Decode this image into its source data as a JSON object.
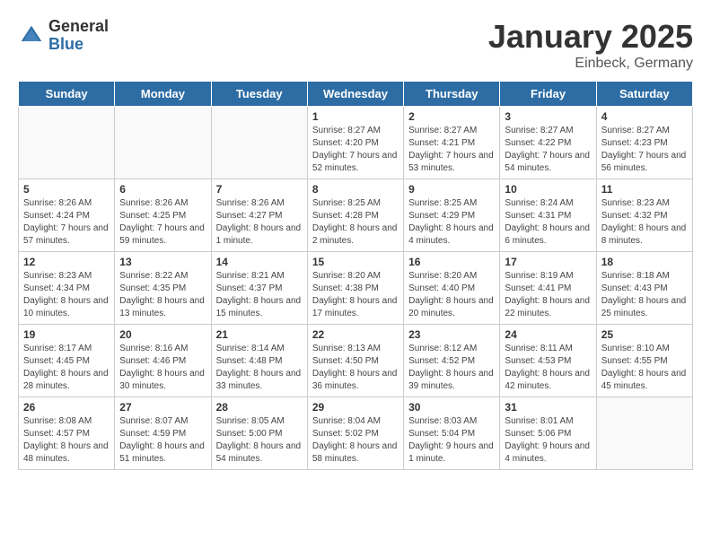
{
  "header": {
    "logo_general": "General",
    "logo_blue": "Blue",
    "month_title": "January 2025",
    "location": "Einbeck, Germany"
  },
  "weekdays": [
    "Sunday",
    "Monday",
    "Tuesday",
    "Wednesday",
    "Thursday",
    "Friday",
    "Saturday"
  ],
  "weeks": [
    [
      {
        "day": "",
        "info": ""
      },
      {
        "day": "",
        "info": ""
      },
      {
        "day": "",
        "info": ""
      },
      {
        "day": "1",
        "info": "Sunrise: 8:27 AM\nSunset: 4:20 PM\nDaylight: 7 hours and 52 minutes."
      },
      {
        "day": "2",
        "info": "Sunrise: 8:27 AM\nSunset: 4:21 PM\nDaylight: 7 hours and 53 minutes."
      },
      {
        "day": "3",
        "info": "Sunrise: 8:27 AM\nSunset: 4:22 PM\nDaylight: 7 hours and 54 minutes."
      },
      {
        "day": "4",
        "info": "Sunrise: 8:27 AM\nSunset: 4:23 PM\nDaylight: 7 hours and 56 minutes."
      }
    ],
    [
      {
        "day": "5",
        "info": "Sunrise: 8:26 AM\nSunset: 4:24 PM\nDaylight: 7 hours and 57 minutes."
      },
      {
        "day": "6",
        "info": "Sunrise: 8:26 AM\nSunset: 4:25 PM\nDaylight: 7 hours and 59 minutes."
      },
      {
        "day": "7",
        "info": "Sunrise: 8:26 AM\nSunset: 4:27 PM\nDaylight: 8 hours and 1 minute."
      },
      {
        "day": "8",
        "info": "Sunrise: 8:25 AM\nSunset: 4:28 PM\nDaylight: 8 hours and 2 minutes."
      },
      {
        "day": "9",
        "info": "Sunrise: 8:25 AM\nSunset: 4:29 PM\nDaylight: 8 hours and 4 minutes."
      },
      {
        "day": "10",
        "info": "Sunrise: 8:24 AM\nSunset: 4:31 PM\nDaylight: 8 hours and 6 minutes."
      },
      {
        "day": "11",
        "info": "Sunrise: 8:23 AM\nSunset: 4:32 PM\nDaylight: 8 hours and 8 minutes."
      }
    ],
    [
      {
        "day": "12",
        "info": "Sunrise: 8:23 AM\nSunset: 4:34 PM\nDaylight: 8 hours and 10 minutes."
      },
      {
        "day": "13",
        "info": "Sunrise: 8:22 AM\nSunset: 4:35 PM\nDaylight: 8 hours and 13 minutes."
      },
      {
        "day": "14",
        "info": "Sunrise: 8:21 AM\nSunset: 4:37 PM\nDaylight: 8 hours and 15 minutes."
      },
      {
        "day": "15",
        "info": "Sunrise: 8:20 AM\nSunset: 4:38 PM\nDaylight: 8 hours and 17 minutes."
      },
      {
        "day": "16",
        "info": "Sunrise: 8:20 AM\nSunset: 4:40 PM\nDaylight: 8 hours and 20 minutes."
      },
      {
        "day": "17",
        "info": "Sunrise: 8:19 AM\nSunset: 4:41 PM\nDaylight: 8 hours and 22 minutes."
      },
      {
        "day": "18",
        "info": "Sunrise: 8:18 AM\nSunset: 4:43 PM\nDaylight: 8 hours and 25 minutes."
      }
    ],
    [
      {
        "day": "19",
        "info": "Sunrise: 8:17 AM\nSunset: 4:45 PM\nDaylight: 8 hours and 28 minutes."
      },
      {
        "day": "20",
        "info": "Sunrise: 8:16 AM\nSunset: 4:46 PM\nDaylight: 8 hours and 30 minutes."
      },
      {
        "day": "21",
        "info": "Sunrise: 8:14 AM\nSunset: 4:48 PM\nDaylight: 8 hours and 33 minutes."
      },
      {
        "day": "22",
        "info": "Sunrise: 8:13 AM\nSunset: 4:50 PM\nDaylight: 8 hours and 36 minutes."
      },
      {
        "day": "23",
        "info": "Sunrise: 8:12 AM\nSunset: 4:52 PM\nDaylight: 8 hours and 39 minutes."
      },
      {
        "day": "24",
        "info": "Sunrise: 8:11 AM\nSunset: 4:53 PM\nDaylight: 8 hours and 42 minutes."
      },
      {
        "day": "25",
        "info": "Sunrise: 8:10 AM\nSunset: 4:55 PM\nDaylight: 8 hours and 45 minutes."
      }
    ],
    [
      {
        "day": "26",
        "info": "Sunrise: 8:08 AM\nSunset: 4:57 PM\nDaylight: 8 hours and 48 minutes."
      },
      {
        "day": "27",
        "info": "Sunrise: 8:07 AM\nSunset: 4:59 PM\nDaylight: 8 hours and 51 minutes."
      },
      {
        "day": "28",
        "info": "Sunrise: 8:05 AM\nSunset: 5:00 PM\nDaylight: 8 hours and 54 minutes."
      },
      {
        "day": "29",
        "info": "Sunrise: 8:04 AM\nSunset: 5:02 PM\nDaylight: 8 hours and 58 minutes."
      },
      {
        "day": "30",
        "info": "Sunrise: 8:03 AM\nSunset: 5:04 PM\nDaylight: 9 hours and 1 minute."
      },
      {
        "day": "31",
        "info": "Sunrise: 8:01 AM\nSunset: 5:06 PM\nDaylight: 9 hours and 4 minutes."
      },
      {
        "day": "",
        "info": ""
      }
    ]
  ]
}
